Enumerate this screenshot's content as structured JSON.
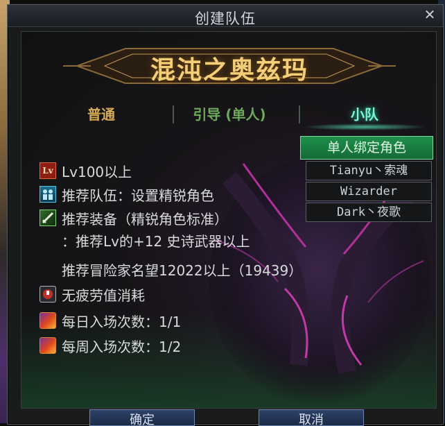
{
  "window": {
    "title": "创建队伍",
    "close_label": "✕"
  },
  "dungeon": {
    "name": "混沌之奥兹玛"
  },
  "tabs": [
    {
      "label": "普通"
    },
    {
      "label": "引导 (单人)"
    },
    {
      "label": "小队",
      "selected": true
    }
  ],
  "info": {
    "level": "Lv100以上",
    "party": "推荐队伍：设置精锐角色",
    "equip": "推荐装备（精锐角色标准）",
    "equip_detail": "：推荐Lv的+12 史诗武器以上",
    "fame": "推荐冒险家名望12022以上（19439）",
    "fatigue": "无疲劳值消耗",
    "daily": "每日入场次数：1/1",
    "weekly": "每周入场次数：1/2",
    "level_icon_text": "Lv"
  },
  "side_panel": {
    "header": "单人绑定角色",
    "members": [
      "Tianyu丶索魂",
      "Wizarder",
      "Dark丶夜歌"
    ]
  },
  "buttons": {
    "confirm": "确定",
    "cancel": "取消"
  },
  "icons": {
    "close": "close-icon",
    "level": "level-badge-icon",
    "party": "party-icon",
    "equip": "sword-icon",
    "fatigue": "fatigue-icon",
    "ticket": "ticket-icon"
  },
  "colors": {
    "tab_normal": "#d6ab52",
    "tab_guide": "#6cab5a",
    "tab_selected": "#7cf6d3",
    "side_header_bg": "#1f8f4b",
    "title_gold": "#f3cf7a"
  }
}
